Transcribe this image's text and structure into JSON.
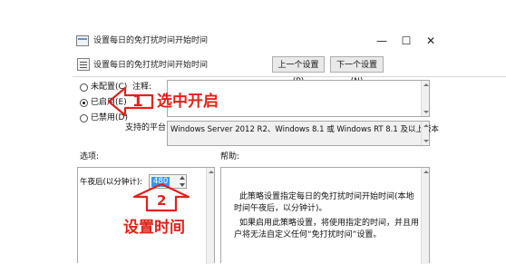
{
  "window": {
    "title": "设置每日的免打扰时间开始时间",
    "header_title": "设置每日的免打扰时间开始时间",
    "minimize": "—",
    "maximize": "☐",
    "close": "✕"
  },
  "nav": {
    "prev": "上一个设置(P)",
    "next": "下一个设置(N)"
  },
  "radios": [
    {
      "label": "未配置(C)",
      "selected": false
    },
    {
      "label": "已启用(E)",
      "selected": true
    },
    {
      "label": "已禁用(D)",
      "selected": false
    }
  ],
  "comment": {
    "label": "注释:",
    "value": ""
  },
  "supported": {
    "label": "支持的平台:",
    "value": "Windows Server 2012 R2、Windows 8.1 或 Windows RT 8.1 及以上版本"
  },
  "options": {
    "label": "选项:",
    "field_label": "午夜后(以分钟计):",
    "field_value": "480"
  },
  "help": {
    "label": "帮助:",
    "para1": "此策略设置指定每日的免打扰时间开始时间(本地时间午夜后，以分钟计)。",
    "para2": "如果启用此策略设置，将使用指定的时间，并且用户将无法自定义任何“免打扰时间”设置。"
  },
  "annotations": {
    "step1_number": "1",
    "step1_text": "选中开启",
    "step2_number": "2",
    "step2_text": "设置时间"
  },
  "colors": {
    "annotation_red": "#e0221b",
    "selection_blue": "#3399ff"
  }
}
